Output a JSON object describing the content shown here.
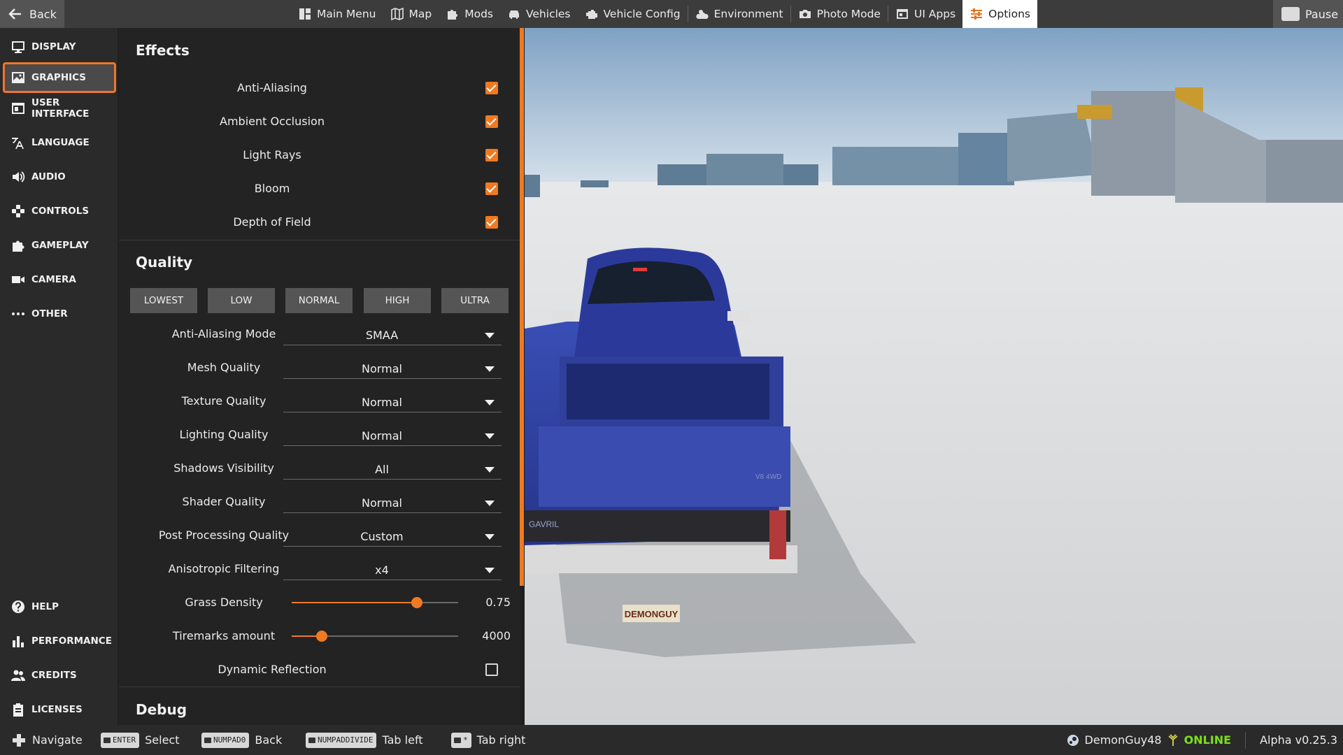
{
  "topbar": {
    "back_label": "Back",
    "pause_label": "Pause",
    "nav": [
      {
        "label": "Main Menu",
        "icon": "main-menu-icon"
      },
      {
        "label": "Map",
        "icon": "map-icon"
      },
      {
        "label": "Mods",
        "icon": "puzzle-icon"
      },
      {
        "label": "Vehicles",
        "icon": "car-icon"
      },
      {
        "label": "Vehicle Config",
        "icon": "engine-icon"
      },
      {
        "label": "Environment",
        "icon": "weather-icon"
      },
      {
        "label": "Photo Mode",
        "icon": "camera-icon"
      },
      {
        "label": "UI Apps",
        "icon": "apps-icon"
      },
      {
        "label": "Options",
        "icon": "sliders-icon",
        "active": true
      }
    ]
  },
  "sidebar": {
    "items": [
      {
        "label": "DISPLAY",
        "icon": "monitor-icon"
      },
      {
        "label": "GRAPHICS",
        "icon": "image-icon",
        "active": true
      },
      {
        "label": "USER INTERFACE",
        "icon": "window-icon"
      },
      {
        "label": "LANGUAGE",
        "icon": "translate-icon"
      },
      {
        "label": "AUDIO",
        "icon": "speaker-icon"
      },
      {
        "label": "CONTROLS",
        "icon": "dpad-icon"
      },
      {
        "label": "GAMEPLAY",
        "icon": "puzzle-icon"
      },
      {
        "label": "CAMERA",
        "icon": "video-camera-icon"
      },
      {
        "label": "OTHER",
        "icon": "more-icon"
      }
    ],
    "bottom_items": [
      {
        "label": "HELP",
        "icon": "help-icon"
      },
      {
        "label": "PERFORMANCE",
        "icon": "bar-chart-icon"
      },
      {
        "label": "CREDITS",
        "icon": "people-icon"
      },
      {
        "label": "LICENSES",
        "icon": "clipboard-icon"
      }
    ]
  },
  "effects": {
    "title": "Effects",
    "items": [
      {
        "label": "Anti-Aliasing",
        "checked": true
      },
      {
        "label": "Ambient Occlusion",
        "checked": true
      },
      {
        "label": "Light Rays",
        "checked": true
      },
      {
        "label": "Bloom",
        "checked": true
      },
      {
        "label": "Depth of Field",
        "checked": true
      }
    ]
  },
  "quality": {
    "title": "Quality",
    "presets": [
      "LOWEST",
      "LOW",
      "NORMAL",
      "HIGH",
      "ULTRA"
    ],
    "dropdowns": [
      {
        "label": "Anti-Aliasing Mode",
        "value": "SMAA"
      },
      {
        "label": "Mesh Quality",
        "value": "Normal"
      },
      {
        "label": "Texture Quality",
        "value": "Normal"
      },
      {
        "label": "Lighting Quality",
        "value": "Normal"
      },
      {
        "label": "Shadows Visibility",
        "value": "All"
      },
      {
        "label": "Shader Quality",
        "value": "Normal"
      },
      {
        "label": "Post Processing Quality",
        "value": "Custom"
      },
      {
        "label": "Anisotropic Filtering",
        "value": "x4"
      }
    ],
    "sliders": [
      {
        "label": "Grass Density",
        "value": "0.75",
        "fraction": 0.75
      },
      {
        "label": "Tiremarks amount",
        "value": "4000",
        "fraction": 0.18
      }
    ],
    "dynamic_reflection": {
      "label": "Dynamic Reflection",
      "checked": false
    }
  },
  "debug": {
    "title": "Debug"
  },
  "viewport": {
    "license_plate": "DEMONGUY",
    "tailgate_text": "GAVRIL",
    "badge_text": "V8 4WD"
  },
  "bottombar": {
    "hints": [
      {
        "key": "",
        "label": "Navigate"
      },
      {
        "key": "ENTER",
        "label": "Select"
      },
      {
        "key": "NUMPAD0",
        "label": "Back"
      },
      {
        "key": "NUMPADDIVIDE",
        "label": "Tab left"
      },
      {
        "key": "*",
        "label": "Tab right"
      }
    ],
    "username": "DemonGuy48",
    "status": "ONLINE",
    "version": "Alpha v0.25.3"
  },
  "colors": {
    "accent": "#f07a22",
    "online": "#7ce01e",
    "vehicle": "#2f3f9a"
  }
}
